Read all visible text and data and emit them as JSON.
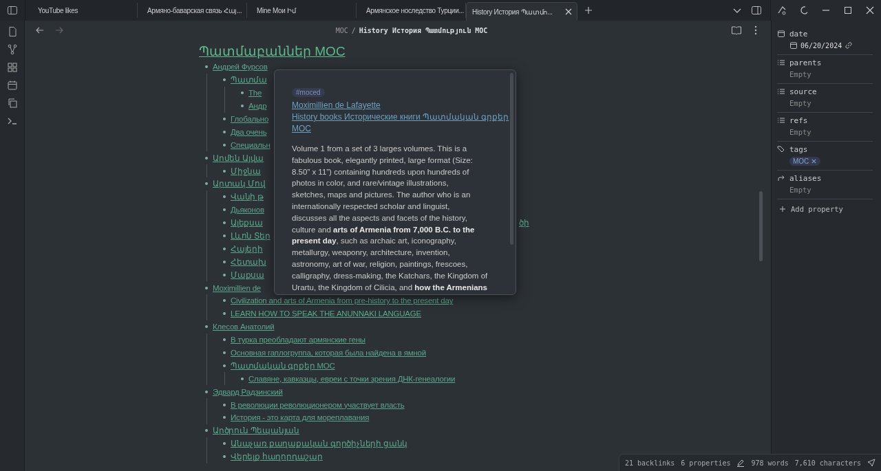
{
  "tabs": [
    {
      "label": "YouTube likes",
      "selected": false
    },
    {
      "label": "Армяно-баварская связь Հայ...",
      "selected": false
    },
    {
      "label": "Mine Мои Իմ",
      "selected": false
    },
    {
      "label": "Армянское носледство Турции...",
      "selected": false
    },
    {
      "label": "History История Պատմո...",
      "selected": true
    }
  ],
  "breadcrumb": {
    "folder": "MOC",
    "separator": "/",
    "title": "History История Պատմություն MOC"
  },
  "heading": "Պատմաբաններ MOC",
  "outline": [
    {
      "text": "Андрей Фурсов",
      "children": [
        {
          "text": "Պատմա",
          "children": [
            {
              "text": "The"
            },
            {
              "text": "Андр"
            }
          ]
        },
        {
          "text": "Глобально"
        },
        {
          "text": "Два очень"
        },
        {
          "text": "Специальн"
        }
      ]
    },
    {
      "text": "Արմեն Այվա",
      "children": [
        {
          "text": "Միջնա"
        }
      ]
    },
    {
      "text": "Արտակ Մով",
      "children": [
        {
          "text": "Վանի թ"
        },
        {
          "text": "Дьяконов"
        },
        {
          "text": "Ալեքսա",
          "tail": "ծի"
        },
        {
          "text": "Լևոն Տեր"
        },
        {
          "text": "Հայերի"
        },
        {
          "text": "Հետախ"
        },
        {
          "text": "Մաքսա"
        }
      ]
    },
    {
      "text": "Moximillien de",
      "children": [
        {
          "text": "Civilization and arts of Armenia from pre-history to the present day"
        },
        {
          "text": "LEARN HOW TO SPEAK THE ANUNNAKI LANGUAGE"
        }
      ]
    },
    {
      "text": "Клесов Анатолий",
      "children": [
        {
          "text": "В турка преобладают армянские гены"
        },
        {
          "text": "Основная гаплогруппа, которая была найдена в ямной"
        },
        {
          "text": "Պատմական գրքեր MOC",
          "children": [
            {
              "text": "Славяне, кавказцы, евреи с точки зрения ДНК-генеалогии"
            }
          ]
        }
      ]
    },
    {
      "text": "Эдвард Радзинский",
      "children": [
        {
          "text": "В революции революционером участвует власть"
        },
        {
          "text": "История - это карта для мореплавания"
        }
      ]
    },
    {
      "text": "Արծրուն Պեպանյան",
      "children": [
        {
          "text": "Անաչառ քաղաքական գործիչների ցանկ"
        },
        {
          "text": "Վերելք հաղորդաշար"
        }
      ]
    }
  ],
  "popover": {
    "tag": "#moced",
    "links": [
      "Moximillien de Lafayette",
      "History books Исторические книги Պատմական գրքեր",
      "MOC"
    ],
    "description_lines": [
      "Volume 1 from a set of 3 larges volumes. This is a",
      "fabulous book, elegantly printed, large format (Size:",
      "8.50” x 11”) containing hundreds upon hundreds of",
      "photos in color, and rare/vintage illustrations,",
      "sketches, maps and pictures. The author who is an",
      "internationally respected scholar and linguist,",
      "discusses all the aspects and facets of the history,",
      "culture and **arts of Armenia from 7,000 B.C. to the**",
      "**present day**, such as archaic art, iconography,",
      "metallurgy, weaponry, architecture, invention,",
      "astronomy, art of war, religion, paintings, frescoes,",
      "calligraphy, dress-making, the Katchars, the Kingdom of",
      "Urartu, the Kingdom of Cilicia, and **how the Armenians**"
    ]
  },
  "properties": [
    {
      "kind": "date",
      "name": "date",
      "value": "06/20/2024"
    },
    {
      "kind": "list",
      "name": "parents",
      "empty_text": "Empty"
    },
    {
      "kind": "list",
      "name": "source",
      "empty_text": "Empty"
    },
    {
      "kind": "list",
      "name": "refs",
      "empty_text": "Empty"
    },
    {
      "kind": "tags",
      "name": "tags",
      "tags": [
        "MOC"
      ]
    },
    {
      "kind": "aliases",
      "name": "aliases",
      "empty_text": "Empty"
    }
  ],
  "add_property": "Add property",
  "status": {
    "backlinks": "21 backlinks",
    "properties": "6 properties",
    "words": "978 words",
    "characters": "7,610 characters"
  }
}
